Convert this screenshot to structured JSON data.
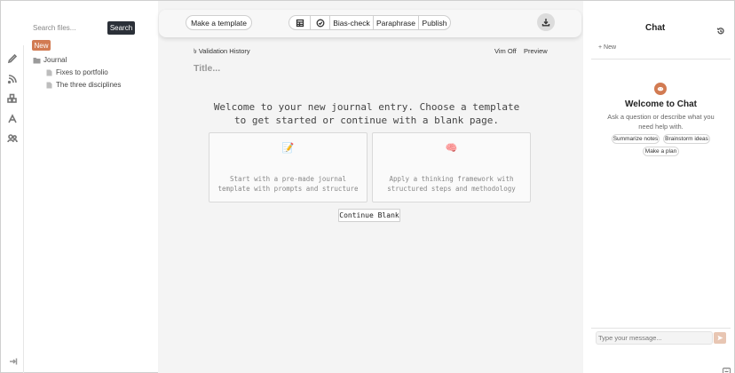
{
  "sidebar": {
    "search_placeholder": "Search files...",
    "search_label": "Search",
    "new_label": "New",
    "tree": [
      {
        "label": "Journal",
        "type": "folder"
      },
      {
        "label": "Fixes to portfolio",
        "type": "file"
      },
      {
        "label": "The three disciplines",
        "type": "file"
      }
    ],
    "rail_icons": [
      "pencil-icon",
      "rss-icon",
      "blocks-icon",
      "font-icon",
      "users-icon"
    ]
  },
  "toolbar": {
    "template_label": "Make a template",
    "bias_label": "Bias-check",
    "paraphrase_label": "Paraphrase",
    "publish_label": "Publish"
  },
  "editor": {
    "validation_history": "৳ Validation History",
    "vim_label": "Vim Off",
    "preview_label": "Preview",
    "title_placeholder": "Title...",
    "welcome": "Welcome to your new journal entry. Choose a template to get started or continue with a blank page.",
    "cards": [
      {
        "icon": "📝",
        "desc": "Start with a pre-made journal template with prompts and structure"
      },
      {
        "icon": "🧠",
        "desc": "Apply a thinking framework with structured steps and methodology"
      }
    ],
    "continue_label": "Continue Blank"
  },
  "chat": {
    "title": "Chat",
    "new_label": "+ New",
    "welcome_title": "Welcome to Chat",
    "welcome_sub": "Ask a question or describe what you need help with.",
    "suggestions": [
      "Summarize notes",
      "Brainstorm ideas",
      "Make a plan"
    ],
    "input_placeholder": "Type your message..."
  },
  "colors": {
    "accent": "#d27b52",
    "dark_button": "#2b3038",
    "editor_bg": "#f4f4f4"
  }
}
